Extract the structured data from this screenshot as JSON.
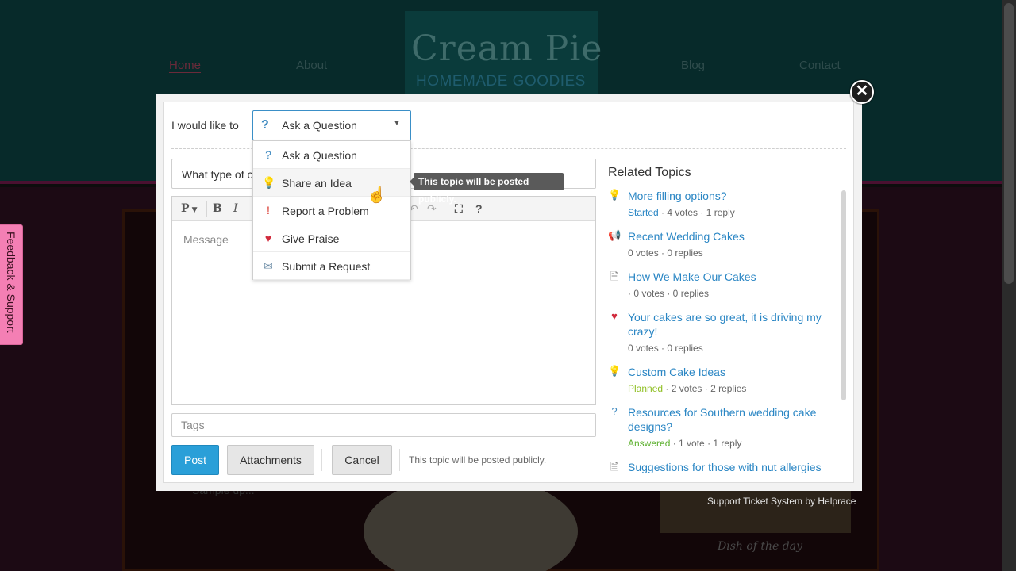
{
  "site": {
    "logo": "Cream Pie",
    "tagline": "HOMEMADE GOODIES",
    "nav": [
      "Home",
      "About",
      "Blog",
      "Contact"
    ],
    "signup": "Sample up...",
    "dish_label": "Dish of the day",
    "credit": "Support Ticket System by Helprace"
  },
  "feedback_tab": {
    "label": "Feedback & Support"
  },
  "modal": {
    "close_glyph": "✕",
    "intent_label": "I would like to",
    "intent_selected": "Ask a Question",
    "title_value": "What type of c",
    "message_placeholder": "Message",
    "tags_placeholder": "Tags",
    "tooltip": "This topic will be posted publicly.",
    "public_note": "This topic will be posted publicly.",
    "buttons": {
      "post": "Post",
      "attachments": "Attachments",
      "cancel": "Cancel"
    },
    "toolbar": {
      "paragraph": "P",
      "bold": "B",
      "italic": "I",
      "undo": "↶",
      "redo": "↷",
      "fullscreen": "⛶",
      "help": "?"
    },
    "dropdown": [
      {
        "label": "Ask a Question",
        "icon": "question-icon",
        "glyph": "?",
        "color": "#3f8ac0"
      },
      {
        "label": "Share an Idea",
        "icon": "lightbulb-icon",
        "glyph": "💡",
        "color": "#e7b416"
      },
      {
        "label": "Report a Problem",
        "icon": "exclamation-icon",
        "glyph": "!",
        "color": "#d9342b"
      },
      {
        "label": "Give Praise",
        "icon": "heart-icon",
        "glyph": "♥",
        "color": "#d12a3c"
      },
      {
        "label": "Submit a Request",
        "icon": "envelope-icon",
        "glyph": "✉",
        "color": "#6f8fa8"
      }
    ]
  },
  "related": {
    "title": "Related Topics",
    "items": [
      {
        "icon": "lightbulb-icon",
        "glyph": "💡",
        "title": "More filling options?",
        "status": "Started",
        "meta": " · 4 votes · 1 reply"
      },
      {
        "icon": "megaphone-icon",
        "glyph": "📢",
        "title": "Recent Wedding Cakes",
        "status": "",
        "meta": "0 votes · 0 replies"
      },
      {
        "icon": "document-icon",
        "glyph": "🗎",
        "title": "How We Make Our Cakes",
        "status": "",
        "meta": " · 0 votes · 0 replies"
      },
      {
        "icon": "heart-icon",
        "glyph": "♥",
        "title": "Your cakes are so great, it is driving my crazy!",
        "status": "",
        "meta": "0 votes · 0 replies"
      },
      {
        "icon": "lightbulb-icon",
        "glyph": "💡",
        "title": "Custom Cake Ideas",
        "status": "Planned",
        "meta": " · 2 votes · 2 replies"
      },
      {
        "icon": "question-icon",
        "glyph": "?",
        "title": "Resources for Southern wedding cake designs?",
        "status": "Answered",
        "meta": " · 1 vote · 1 reply"
      },
      {
        "icon": "document-icon",
        "glyph": "🗎",
        "title": "Suggestions for those with nut allergies",
        "status": "",
        "meta": ""
      }
    ]
  },
  "colors": {
    "accent": "#2a9fd8",
    "link": "#2a86c4",
    "feedback_tab": "#f47fb4"
  }
}
